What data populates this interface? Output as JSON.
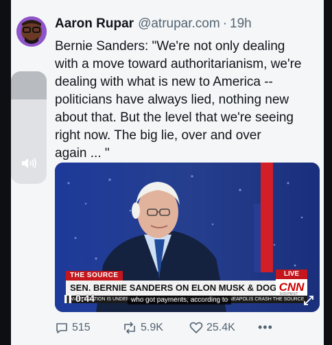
{
  "tweet": {
    "author_name": "Aaron Rupar",
    "author_handle": "@atrupar.com",
    "separator": "·",
    "time": "19h",
    "text": "Bernie Sanders: \"We're not only dealing\nwith a move toward authoritarianism, we're\ndealing with what is new to America --\npoliticians have always lied, nothing new\nabout that. But the level that we're seeing\nright now. The big lie, over and over\nagain ... \""
  },
  "volume": {
    "level": 0.25,
    "icon": "speaker-icon"
  },
  "video": {
    "show_name": "THE SOURCE",
    "live_label": "LIVE",
    "headline": "SEN. BERNIE SANDERS ON ELON MUSK & DOGE",
    "network_logo": "CNN",
    "clock": "5:03 PM ET",
    "ticker": "INVESTIGATION IS UNDERWAY INTO HOW A DELTA FLIGHT FROM MINNEAPOLIS CRASH THE SOURCE",
    "elapsed": "0:44",
    "caption": "who got payments, according to"
  },
  "actions": {
    "replies": "515",
    "reposts": "5.9K",
    "likes": "25.4K",
    "more": "•••"
  },
  "colors": {
    "cnn_red": "#c4161c",
    "studio_blue": "#1b2a6e",
    "secondary_text": "#536471"
  }
}
